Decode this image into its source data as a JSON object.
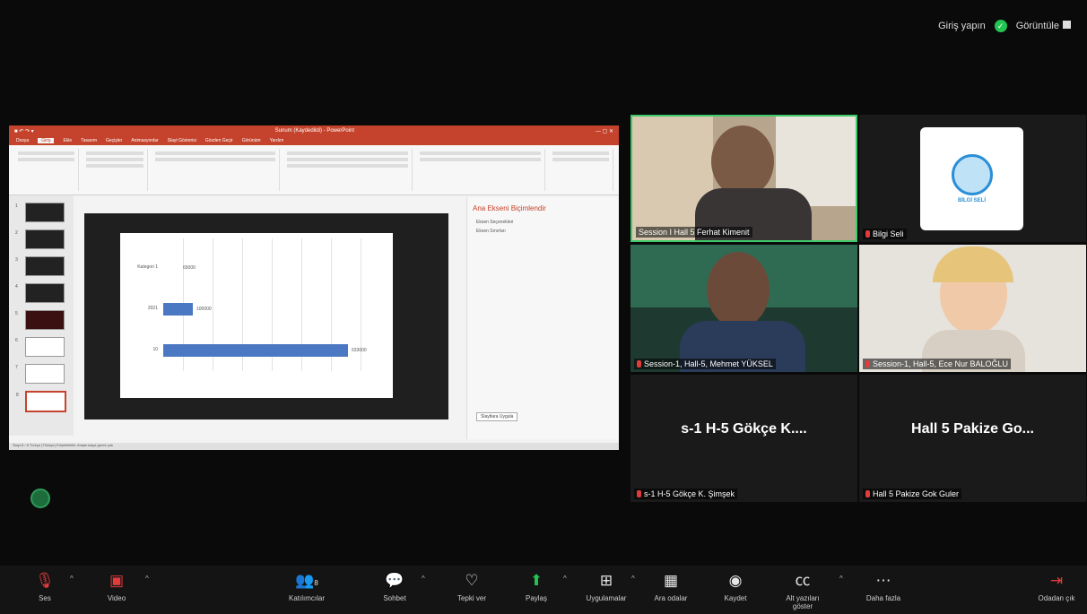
{
  "top": {
    "login_text": "Giriş yapın",
    "view_text": "Görüntüle"
  },
  "shared_window": {
    "title": "Sunum (Kaydedildi) - PowerPoint",
    "tabs": [
      "Dosya",
      "Giriş",
      "Ekle",
      "Tasarım",
      "Geçişler",
      "Animasyonlar",
      "Slayt Gösterisi",
      "Gözden Geçir",
      "Görünüm",
      "Yardım"
    ],
    "active_tab": "Giriş",
    "panel_title": "Ana Ekseni Biçimlendir",
    "panel_rows": [
      "Eksen Seçenekleri",
      "Eksen Sınırları"
    ],
    "panel_button": "Slaytlara Uygula",
    "statusbar": "Slayt 8 / 8   Türkçe (Türkiye)   Erişilebilirlik: Araştırmaya gerek yok",
    "chart_data": {
      "type": "bar",
      "categories": [
        "Kategori 1",
        "2021",
        "10"
      ],
      "values": [
        65000,
        100000,
        633000
      ],
      "labels": [
        "65000",
        "100000",
        "633000"
      ]
    }
  },
  "participants": [
    {
      "name": "Session I Hall 5 Ferhat Kimenit"
    },
    {
      "name": "Bilgi Seli",
      "logo_text": "BİLGİ SELİ"
    },
    {
      "name": "Session-1, Hall-5, Mehmet YÜKSEL"
    },
    {
      "name": "Session-1, Hall-5, Ece Nur BALOĞLU"
    },
    {
      "big": "s-1 H-5 Gökçe K....",
      "name": "s-1 H-5 Gökçe K. Şimşek"
    },
    {
      "big": "Hall 5 Pakize Go...",
      "name": "Hall 5 Pakize Gok Guler"
    }
  ],
  "toolbar": {
    "mute": "Ses",
    "video": "Video",
    "participants": "Katılımcılar",
    "participants_count": "8",
    "chat": "Sohbet",
    "react": "Tepki ver",
    "share": "Paylaş",
    "apps": "Uygulamalar",
    "rooms": "Ara odalar",
    "record": "Kaydet",
    "captions": "Alt yazıları göster",
    "more": "Daha fazla",
    "leave": "Odadan çık"
  }
}
